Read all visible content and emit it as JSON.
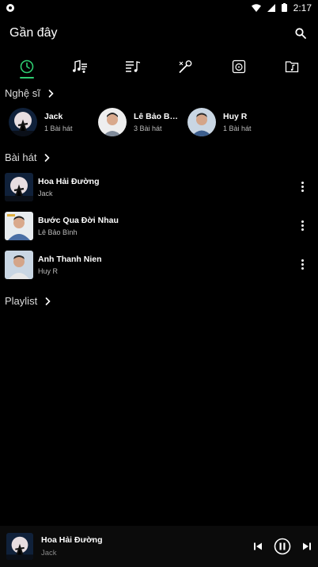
{
  "status_bar": {
    "time": "2:17"
  },
  "header": {
    "title": "Gần đây"
  },
  "tabs": [
    {
      "icon": "recent-clock-icon",
      "active": true
    },
    {
      "icon": "music-notes-icon",
      "active": false
    },
    {
      "icon": "playlist-icon",
      "active": false
    },
    {
      "icon": "microphone-icon",
      "active": false
    },
    {
      "icon": "album-icon",
      "active": false
    },
    {
      "icon": "music-folder-icon",
      "active": false
    }
  ],
  "sections": {
    "artists": "Nghệ sĩ",
    "songs": "Bài hát",
    "playlist": "Playlist"
  },
  "artists": [
    {
      "name": "Jack",
      "count": "1 Bài hát"
    },
    {
      "name": "Lê Bảo Bình",
      "count": "3 Bài hát"
    },
    {
      "name": "Huy R",
      "count": "1 Bài hát"
    }
  ],
  "songs": [
    {
      "title": "Hoa Hải Đường",
      "artist": "Jack"
    },
    {
      "title": "Bước Qua Đời Nhau",
      "artist": "Lê Bảo Bình"
    },
    {
      "title": "Anh Thanh Nien",
      "artist": "Huy R"
    }
  ],
  "player": {
    "title": "Hoa Hải Đường",
    "artist": "Jack"
  },
  "colors": {
    "accent": "#2ecc71",
    "background": "#000000"
  }
}
